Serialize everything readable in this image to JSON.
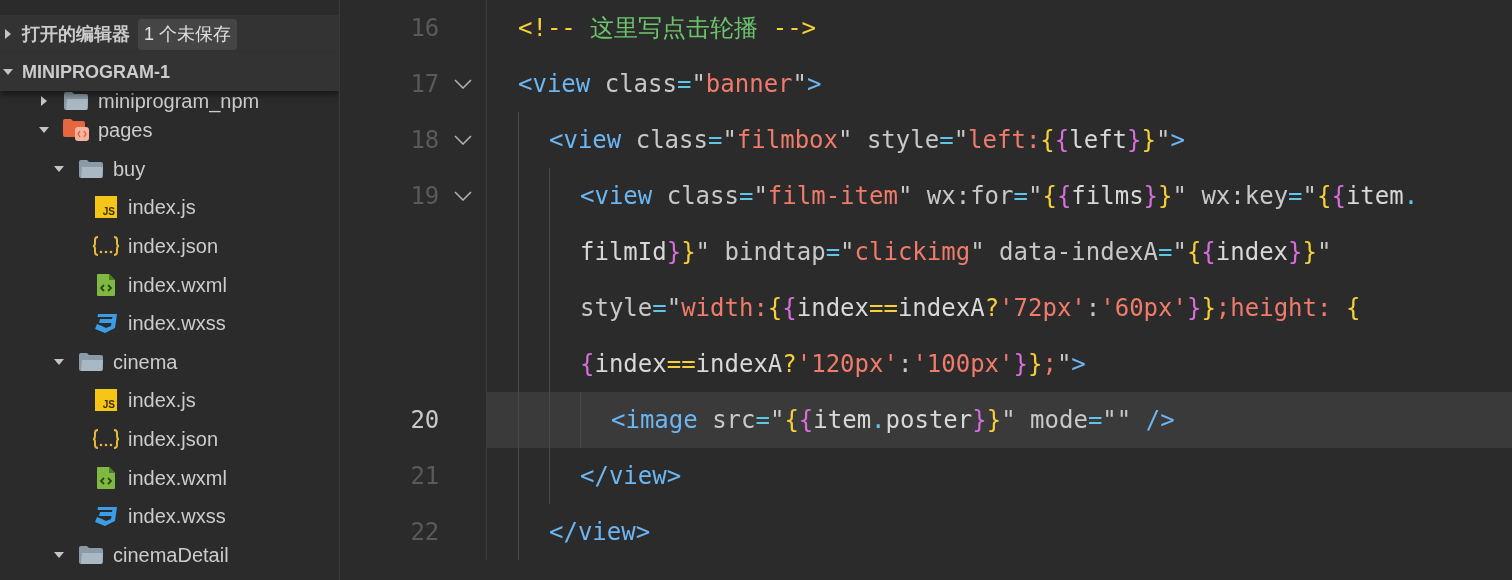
{
  "explorer": {
    "sections": [
      {
        "title": "打开的编辑器",
        "expanded": false,
        "badge": "1 个未保存"
      },
      {
        "title": "MINIPROGRAM-1",
        "expanded": true
      }
    ],
    "tree": [
      {
        "kind": "folder",
        "name": "miniprogram_npm",
        "expanded": false
      },
      {
        "kind": "pages-folder",
        "name": "pages",
        "expanded": true,
        "children": [
          {
            "kind": "folder",
            "name": "buy",
            "expanded": true,
            "children": [
              {
                "kind": "js",
                "name": "index.js",
                "icon_text": "JS"
              },
              {
                "kind": "json",
                "name": "index.json"
              },
              {
                "kind": "wxml",
                "name": "index.wxml"
              },
              {
                "kind": "wxss",
                "name": "index.wxss"
              }
            ]
          },
          {
            "kind": "folder",
            "name": "cinema",
            "expanded": true,
            "children": [
              {
                "kind": "js",
                "name": "index.js",
                "icon_text": "JS"
              },
              {
                "kind": "json",
                "name": "index.json"
              },
              {
                "kind": "wxml",
                "name": "index.wxml"
              },
              {
                "kind": "wxss",
                "name": "index.wxss"
              }
            ]
          },
          {
            "kind": "folder",
            "name": "cinemaDetail",
            "expanded": true
          }
        ]
      }
    ]
  },
  "editor": {
    "lines": [
      {
        "number": "16",
        "foldable": false,
        "current": false,
        "segments": [
          [
            {
              "text": "<!-- ",
              "kind": "cpunct"
            },
            {
              "text": "这里写点击轮播",
              "kind": "comment"
            },
            {
              "text": " -->",
              "kind": "cpunct"
            }
          ]
        ]
      },
      {
        "number": "17",
        "foldable": true,
        "current": false,
        "segments": [
          [
            {
              "text": "<view",
              "kind": "tag"
            },
            {
              "text": " class",
              "kind": "attr"
            },
            {
              "text": "=",
              "kind": "op"
            },
            {
              "text": "\"",
              "kind": "q"
            },
            {
              "text": "banner",
              "kind": "str"
            },
            {
              "text": "\"",
              "kind": "q"
            },
            {
              "text": ">",
              "kind": "tag"
            }
          ]
        ],
        "children": [
          {
            "number": "18",
            "foldable": true,
            "current": false,
            "segments": [
              [
                {
                  "text": "<view",
                  "kind": "tag"
                },
                {
                  "text": " class",
                  "kind": "attr"
                },
                {
                  "text": "=",
                  "kind": "op"
                },
                {
                  "text": "\"",
                  "kind": "q"
                },
                {
                  "text": "filmbox",
                  "kind": "str"
                },
                {
                  "text": "\"",
                  "kind": "q"
                },
                {
                  "text": " style",
                  "kind": "attr"
                },
                {
                  "text": "=",
                  "kind": "op"
                },
                {
                  "text": "\"",
                  "kind": "q"
                },
                {
                  "text": "left:",
                  "kind": "str"
                },
                {
                  "text": "{",
                  "kind": "b1"
                },
                {
                  "text": "{",
                  "kind": "b2"
                },
                {
                  "text": "left",
                  "kind": "plain"
                },
                {
                  "text": "}",
                  "kind": "b2"
                },
                {
                  "text": "}",
                  "kind": "b1"
                },
                {
                  "text": "\"",
                  "kind": "q"
                },
                {
                  "text": ">",
                  "kind": "tag"
                }
              ]
            ],
            "children": [
              {
                "number": "19",
                "foldable": true,
                "current": false,
                "segments": [
                  [
                    {
                      "text": "<view",
                      "kind": "tag"
                    },
                    {
                      "text": " class",
                      "kind": "attr"
                    },
                    {
                      "text": "=",
                      "kind": "op"
                    },
                    {
                      "text": "\"",
                      "kind": "q"
                    },
                    {
                      "text": "film-item",
                      "kind": "str"
                    },
                    {
                      "text": "\"",
                      "kind": "q"
                    },
                    {
                      "text": " wx:for",
                      "kind": "attr"
                    },
                    {
                      "text": "=",
                      "kind": "op"
                    },
                    {
                      "text": "\"",
                      "kind": "q"
                    },
                    {
                      "text": "{",
                      "kind": "b1"
                    },
                    {
                      "text": "{",
                      "kind": "b2"
                    },
                    {
                      "text": "films",
                      "kind": "plain"
                    },
                    {
                      "text": "}",
                      "kind": "b2"
                    },
                    {
                      "text": "}",
                      "kind": "b1"
                    },
                    {
                      "text": "\"",
                      "kind": "q"
                    },
                    {
                      "text": " wx:key",
                      "kind": "attr"
                    },
                    {
                      "text": "=",
                      "kind": "op"
                    },
                    {
                      "text": "\"",
                      "kind": "q"
                    },
                    {
                      "text": "{",
                      "kind": "b1"
                    },
                    {
                      "text": "{",
                      "kind": "b2"
                    },
                    {
                      "text": "item",
                      "kind": "plain"
                    },
                    {
                      "text": ".",
                      "kind": "op"
                    }
                  ],
                  [
                    {
                      "text": "filmId",
                      "kind": "plain"
                    },
                    {
                      "text": "}",
                      "kind": "b2"
                    },
                    {
                      "text": "}",
                      "kind": "b1"
                    },
                    {
                      "text": "\"",
                      "kind": "q"
                    },
                    {
                      "text": " bindtap",
                      "kind": "attr"
                    },
                    {
                      "text": "=",
                      "kind": "op"
                    },
                    {
                      "text": "\"",
                      "kind": "q"
                    },
                    {
                      "text": "clickimg",
                      "kind": "str"
                    },
                    {
                      "text": "\"",
                      "kind": "q"
                    },
                    {
                      "text": " data-indexA",
                      "kind": "attr"
                    },
                    {
                      "text": "=",
                      "kind": "op"
                    },
                    {
                      "text": "\"",
                      "kind": "q"
                    },
                    {
                      "text": "{",
                      "kind": "b1"
                    },
                    {
                      "text": "{",
                      "kind": "b2"
                    },
                    {
                      "text": "index",
                      "kind": "plain"
                    },
                    {
                      "text": "}",
                      "kind": "b2"
                    },
                    {
                      "text": "}",
                      "kind": "b1"
                    },
                    {
                      "text": "\"",
                      "kind": "q"
                    }
                  ],
                  [
                    {
                      "text": "style",
                      "kind": "attr"
                    },
                    {
                      "text": "=",
                      "kind": "op"
                    },
                    {
                      "text": "\"",
                      "kind": "q"
                    },
                    {
                      "text": "width:",
                      "kind": "str"
                    },
                    {
                      "text": "{",
                      "kind": "b1"
                    },
                    {
                      "text": "{",
                      "kind": "b2"
                    },
                    {
                      "text": "index",
                      "kind": "plain"
                    },
                    {
                      "text": "==",
                      "kind": "yop"
                    },
                    {
                      "text": "indexA",
                      "kind": "plain"
                    },
                    {
                      "text": "?",
                      "kind": "yop"
                    },
                    {
                      "text": "'72px'",
                      "kind": "str"
                    },
                    {
                      "text": ":",
                      "kind": "q"
                    },
                    {
                      "text": "'60px'",
                      "kind": "str"
                    },
                    {
                      "text": "}",
                      "kind": "b2"
                    },
                    {
                      "text": "}",
                      "kind": "b1"
                    },
                    {
                      "text": ";height: ",
                      "kind": "str"
                    },
                    {
                      "text": "{",
                      "kind": "b1"
                    }
                  ],
                  [
                    {
                      "text": "{",
                      "kind": "b2"
                    },
                    {
                      "text": "index",
                      "kind": "plain"
                    },
                    {
                      "text": "==",
                      "kind": "yop"
                    },
                    {
                      "text": "indexA",
                      "kind": "plain"
                    },
                    {
                      "text": "?",
                      "kind": "yop"
                    },
                    {
                      "text": "'120px'",
                      "kind": "str"
                    },
                    {
                      "text": ":",
                      "kind": "q"
                    },
                    {
                      "text": "'100px'",
                      "kind": "str"
                    },
                    {
                      "text": "}",
                      "kind": "b2"
                    },
                    {
                      "text": "}",
                      "kind": "b1"
                    },
                    {
                      "text": ";",
                      "kind": "str"
                    },
                    {
                      "text": "\"",
                      "kind": "q"
                    },
                    {
                      "text": ">",
                      "kind": "tag"
                    }
                  ]
                ],
                "children": [
                  {
                    "number": "20",
                    "foldable": false,
                    "current": true,
                    "segments": [
                      [
                        {
                          "text": "<image",
                          "kind": "tag"
                        },
                        {
                          "text": " src",
                          "kind": "attr"
                        },
                        {
                          "text": "=",
                          "kind": "op"
                        },
                        {
                          "text": "\"",
                          "kind": "q"
                        },
                        {
                          "text": "{",
                          "kind": "b1"
                        },
                        {
                          "text": "{",
                          "kind": "b2"
                        },
                        {
                          "text": "item",
                          "kind": "plain"
                        },
                        {
                          "text": ".",
                          "kind": "op"
                        },
                        {
                          "text": "poster",
                          "kind": "plain"
                        },
                        {
                          "text": "}",
                          "kind": "b2"
                        },
                        {
                          "text": "}",
                          "kind": "b1"
                        },
                        {
                          "text": "\"",
                          "kind": "q"
                        },
                        {
                          "text": " mode",
                          "kind": "attr"
                        },
                        {
                          "text": "=",
                          "kind": "op"
                        },
                        {
                          "text": "\"\"",
                          "kind": "q"
                        },
                        {
                          "text": " />",
                          "kind": "tag"
                        }
                      ]
                    ]
                  }
                ]
              },
              {
                "number": "21",
                "foldable": false,
                "current": false,
                "segments": [
                  [
                    {
                      "text": "</view>",
                      "kind": "tag"
                    }
                  ]
                ]
              }
            ]
          },
          {
            "number": "22",
            "foldable": false,
            "current": false,
            "segments": [
              [
                {
                  "text": "</view>",
                  "kind": "tag"
                }
              ]
            ]
          }
        ]
      }
    ]
  }
}
